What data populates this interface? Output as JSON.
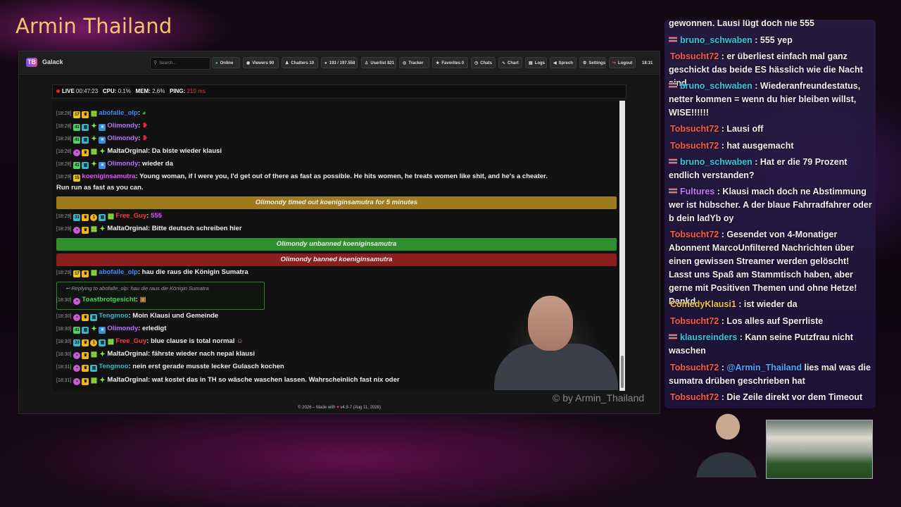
{
  "stream": {
    "title": "Armin_Thailand",
    "display_title": "Armin Thailand",
    "watermark": "© by Armin_Thailand"
  },
  "app": {
    "name": "Galack",
    "logo": "TB",
    "search_placeholder": "Search...",
    "toolbar": [
      {
        "icon": "online-dot-icon",
        "label": "Online"
      },
      {
        "icon": "eye-icon",
        "label": "Viewers",
        "count": "90"
      },
      {
        "icon": "users-icon",
        "label": "Chatters",
        "count": "10"
      },
      {
        "icon": "chat-bubble-icon",
        "label": "193 / 197.558"
      },
      {
        "icon": "user-icon",
        "label": "Userlist",
        "count": "821"
      },
      {
        "icon": "tracker-icon",
        "label": "Tracker"
      },
      {
        "icon": "star-icon",
        "label": "Favorites",
        "count": "0"
      },
      {
        "icon": "clock-icon",
        "label": "Chats"
      },
      {
        "icon": "chart-icon",
        "label": "Chart"
      },
      {
        "icon": "logs-icon",
        "label": "Logs"
      },
      {
        "icon": "speech-icon",
        "label": "Sprech"
      },
      {
        "icon": "gear-icon",
        "label": "Settings"
      },
      {
        "icon": "logout-icon",
        "label": "Logout"
      }
    ],
    "clock": "18:31",
    "status": {
      "live": "LIVE",
      "uptime": "00:47:23",
      "cpu_label": "CPU:",
      "cpu": "0.1%",
      "mem_label": "MEM:",
      "mem": "2.6%",
      "ping_label": "PING:",
      "ping": "210 ms"
    },
    "footer": {
      "prefix": "© 2026 – Made with",
      "suffix": "v4.9-7 (Aug 11, 2026)"
    },
    "messages": [
      {
        "time": "[18:28]",
        "user": "abofalle_olp",
        "text": ""
      },
      {
        "time": "[18:28]",
        "user": "Olimondy",
        "text": ""
      },
      {
        "time": "[18:28]",
        "user": "Olimondy",
        "text": ""
      },
      {
        "time": "[18:28]",
        "user": "MaltaOrginal",
        "text": "Da biste wieder klausi"
      },
      {
        "time": "[18:28]",
        "user": "Olimondy",
        "text": "wieder da"
      },
      {
        "time": "[18:29]",
        "user": "koeniginsamutra",
        "text": "Young woman, if I were you, I'd get out of there as fast as possible. He hits women, he treats women like shit, and he's a cheater.",
        "text2": "Run run as fast as you can."
      },
      {
        "time": "[18:29]",
        "user": "Free_Guy",
        "text": "555"
      },
      {
        "time": "[18:29]",
        "user": "MaltaOrginal",
        "text": "Bitte deutsch schreiben hier"
      },
      {
        "time": "[18:29]",
        "user": "abofalle_olp",
        "text": "hau die raus die Königin Sumatra"
      },
      {
        "time": "[18:30]",
        "user": "Toastbrotgesicht",
        "text": ""
      },
      {
        "time": "[18:30]",
        "user": "Tengmoo",
        "text": "Moin Klausi und Gemeinde"
      },
      {
        "time": "[18:30]",
        "user": "Olimondy",
        "text": "erledigt"
      },
      {
        "time": "[18:30]",
        "user": "Free_Guy",
        "text": "blue clause is total normal"
      },
      {
        "time": "[18:30]",
        "user": "MaltaOrginal",
        "text": "fährste wieder nach nepal klausi"
      },
      {
        "time": "[18:31]",
        "user": "Tengmoo",
        "text": "nein erst gerade musste lecker Gulasch kochen"
      },
      {
        "time": "[18:31]",
        "user": "MaltaOrginal",
        "text": "wat kostet das in TH so wäsche waschen lassen. Wahrscheinlich fast nix oder"
      }
    ],
    "system": {
      "timeout": "Olimondy timed out koeniginsamutra for 5 minutes",
      "unban": "Olimondy unbanned koeniginsamutra",
      "ban": "Olimondy banned koeniginsamutra"
    },
    "reply": {
      "text": "Replying to abofalle_olp: hau die raus die Königin Sumatra"
    },
    "colors": {
      "timeout": "#a07a1e",
      "unban": "#2f8f2f",
      "ban": "#8b1f1f"
    }
  },
  "sidechat": [
    {
      "user": "",
      "text": "gewonnen. Lausi lügt doch nie 555"
    },
    {
      "user": "bruno_schwaben",
      "text": "555 yep"
    },
    {
      "user": "Tobsucht72",
      "text": "er überliest einfach mal ganz geschickt das beide ES hässlich wie die Nacht sind"
    },
    {
      "user": "bruno_schwaben",
      "text": "Wiederanfreundestatus, netter kommen = wenn du hier bleiben willst, WISE!!!!!!"
    },
    {
      "user": "Tobsucht72",
      "text": "Lausi off"
    },
    {
      "user": "Tobsucht72",
      "text": "hat ausgemacht"
    },
    {
      "user": "bruno_schwaben",
      "text": "Hat er die 79 Prozent endlich verstanden?"
    },
    {
      "user": "Fultures",
      "text": "Klausi mach doch ne Abstimmung wer ist hübscher. A der blaue Fahrradfahrer oder b dein ladYb oy"
    },
    {
      "user": "Tobsucht72",
      "text": "Gesendet von 4-Monatiger Abonnent MarcoUnfiltered Nachrichten über einen gewissen Streamer werden gelöscht! Lasst uns Spaß am Stammtisch haben, aber gerne mit Positiven Themen und ohne Hetze! Dankd"
    },
    {
      "user": "ComedyKlausi1",
      "text": "ist wieder da"
    },
    {
      "user": "Tobsucht72",
      "text": "Los alles auf Sperrliste"
    },
    {
      "user": "klausreinders",
      "text": "Kann seine Putzfrau nicht waschen"
    },
    {
      "user": "Tobsucht72",
      "mention": "@Armin_Thailand",
      "text": "lies mal was die sumatra drüben geschrieben hat"
    },
    {
      "user": "Tobsucht72",
      "text": "Die Zeile direkt vor dem Timeout"
    }
  ]
}
